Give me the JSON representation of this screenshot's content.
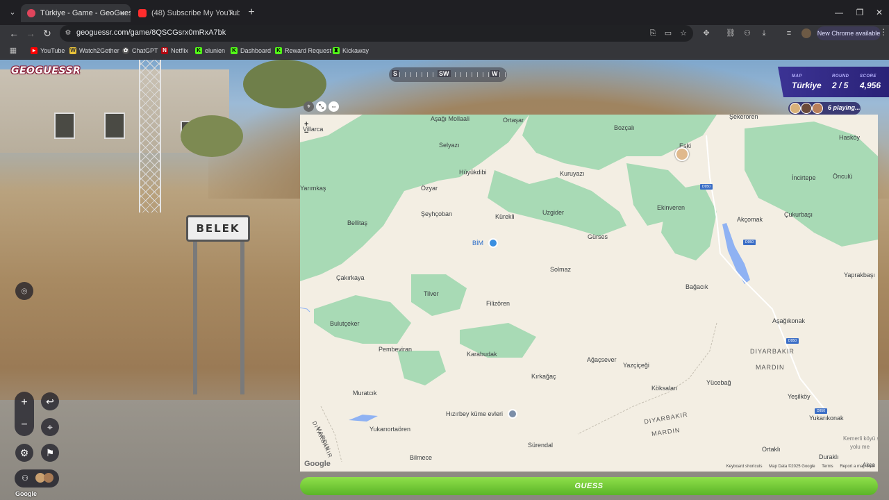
{
  "browser": {
    "tabs": [
      {
        "title": "Türkiye - Game - GeoGuessr",
        "active": true
      },
      {
        "title": "(48) Subscribe My YouTube Cha",
        "active": false
      }
    ],
    "url": "geoguessr.com/game/8QSCGsrx0mRxA7bk",
    "update_chip": "New Chrome available",
    "bookmarks": [
      "YouTube",
      "Watch2Gether",
      "ChatGPT",
      "Netflix",
      "elunien",
      "Dashboard",
      "Reward Request",
      "Kickaway"
    ]
  },
  "game": {
    "logo": "GEOGUESSR",
    "compass": {
      "left": "S",
      "center": "SW",
      "right": "W"
    },
    "status": {
      "map_label": "MAP",
      "map_value": "Türkiye",
      "round_label": "ROUND",
      "round_value": "2 / 5",
      "score_label": "SCORE",
      "score_value": "4,956"
    },
    "players_text": "6 playing...",
    "sign_text": "BELEK",
    "sv_attribution": "Google",
    "guess_label": "GUESS"
  },
  "map": {
    "labels": {
      "asagi_mollaali": "Aşağı Mollaali",
      "ortazar": "Ortaşar",
      "bozcali": "Bozçalı",
      "sekeroren": "Şekeroren",
      "villarca": "Villarca",
      "selyazi": "Selyazı",
      "eski": "Eski",
      "haskoy": "Hasköy",
      "huyukdibi": "Hüyükdibi",
      "kuruyazi": "Kuruyazı",
      "incirtepe": "İncirtepe",
      "onculu": "Önculü",
      "yarimkas": "Yarımkaş",
      "ozyar": "Özyar",
      "ekinveren": "Ekinveren",
      "akcomak": "Akçomak",
      "cukurbasi": "Çukurbaşı",
      "bellitas": "Bellitaş",
      "seyhcoban": "Şeyhçoban",
      "kurekli": "Kürekli",
      "uzgider": "Uzgider",
      "gurses": "Gürses",
      "bim": "BİM",
      "solmaz": "Solmaz",
      "yaprakbasi": "Yaprakbaşı",
      "bagacik": "Bağacık",
      "cakirkaya": "Çakırkaya",
      "tilver": "Tilver",
      "filizoren": "Filizören",
      "asagikonak": "Aşağıkonak",
      "bulutceker": "Bulutçeker",
      "diyarbakir1": "DIYARBAKIR",
      "mardin1": "MARDIN",
      "pembeviran": "Pembeviran",
      "karabudak": "Karabudak",
      "agacsever": "Ağaçsever",
      "yazcicegi": "Yazçiçeği",
      "kirkagac": "Kırkağaç",
      "koksalan": "Köksalan",
      "yucebag": "Yücebağ",
      "muratcik": "Muratcık",
      "yesilkoy": "Yeşilköy",
      "hizirbey": "Hızırbey küme evleri",
      "diyarbakir2": "DIYARBAKIR",
      "yukarikonak": "Yukarıkonak",
      "diyarbakir3": "DIYARBAKIR",
      "mardin2": "MARDIN",
      "mardin3": "MARDIN",
      "yukariortaoren": "Yukarıortaören",
      "kemerli": "Kemerli köyü s",
      "yolu": "yolu me",
      "surendal": "Sürendal",
      "ortakli": "Ortaklı",
      "durakli": "Duraklı",
      "bilmece": "Bilmece",
      "akca": "Akça"
    },
    "roads": {
      "d950a": "D950",
      "d950b": "D950",
      "d950c": "D950",
      "d950d": "D950"
    },
    "zoom_in": "+",
    "zoom_out": "−",
    "google": "Google",
    "footer": {
      "shortcuts": "Keyboard shortcuts",
      "data": "Map Data ©2025 Google",
      "terms": "Terms",
      "report": "Report a map error"
    }
  },
  "colors": {
    "guess_green": "#6cc530",
    "panel_purple": "#3b3394",
    "map_green": "#a8dab5",
    "map_land": "#f3eee3"
  }
}
